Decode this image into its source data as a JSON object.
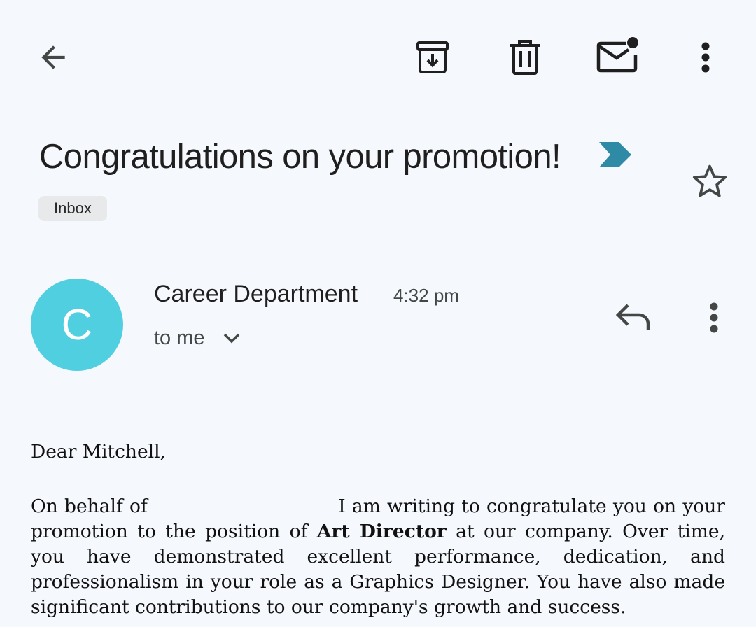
{
  "toolbar": {
    "back_icon": "arrow-back-icon",
    "archive_icon": "archive-icon",
    "delete_icon": "trash-icon",
    "unread_icon": "mark-unread-icon",
    "more_icon": "more-vert-icon"
  },
  "email": {
    "subject": "Congratulations on your promotion!",
    "important_marker_color": "#2f8aa5",
    "label": "Inbox",
    "star_icon": "star-outline-icon"
  },
  "sender": {
    "avatar_letter": "C",
    "avatar_color": "#4fcfe0",
    "name": "Career Department",
    "time": "4:32 pm",
    "recipient": "to me",
    "reply_icon": "reply-icon",
    "more_icon": "more-vert-icon"
  },
  "body": {
    "greeting": "Dear Mitchell,",
    "text_before_redaction": "On behalf of",
    "text_after_redaction": " I am writing to congratulate you on your promotion to the position of ",
    "new_role": "Art Director",
    "text_after_role": " at our company. Over time, you have demonstrated excellent performance, dedication, and professionalism in your role as a Graphics Designer. You have also made significant contributions to our company's growth and success."
  }
}
